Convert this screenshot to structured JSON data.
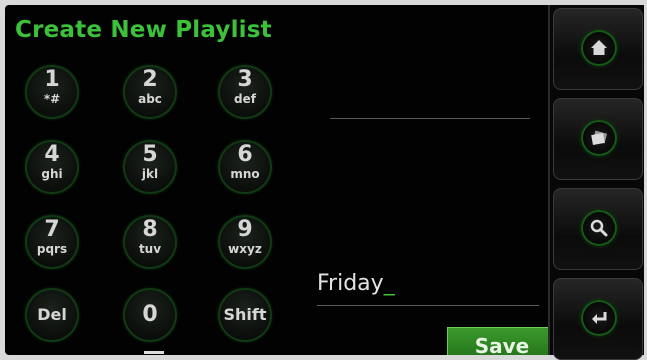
{
  "header": {
    "title": "Create New Playlist"
  },
  "keypad": {
    "keys": [
      {
        "digit": "1",
        "letters": "*#"
      },
      {
        "digit": "2",
        "letters": "abc"
      },
      {
        "digit": "3",
        "letters": "def"
      },
      {
        "digit": "4",
        "letters": "ghi"
      },
      {
        "digit": "5",
        "letters": "jkl"
      },
      {
        "digit": "6",
        "letters": "mno"
      },
      {
        "digit": "7",
        "letters": "pqrs"
      },
      {
        "digit": "8",
        "letters": "tuv"
      },
      {
        "digit": "9",
        "letters": "wxyz"
      }
    ],
    "del_label": "Del",
    "zero_label": "0",
    "shift_label": "Shift"
  },
  "entry": {
    "value": "Friday",
    "caret": "_"
  },
  "actions": {
    "save_label": "Save"
  },
  "sidebar": {
    "icons": [
      "home-icon",
      "albums-icon",
      "search-icon",
      "enter-icon"
    ]
  },
  "colors": {
    "accent": "#3cc23a",
    "save_bg": "#2e8a22",
    "background": "#020202"
  }
}
